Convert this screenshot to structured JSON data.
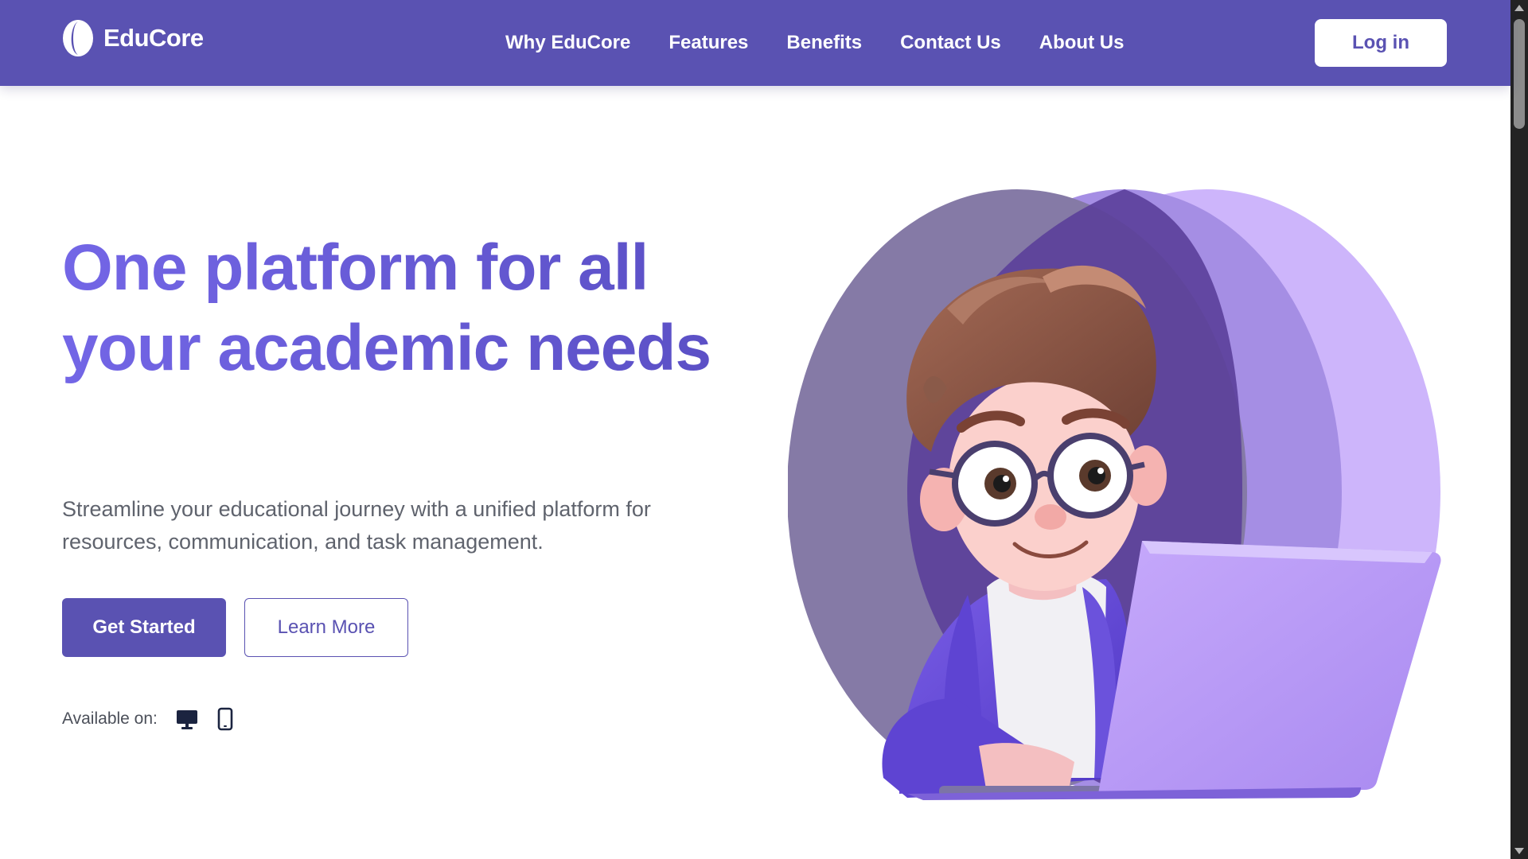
{
  "header": {
    "brand_name": "EduCore",
    "logo_icon": "half-moon-logo-icon",
    "nav": [
      {
        "label": "Why EduCore"
      },
      {
        "label": "Features"
      },
      {
        "label": "Benefits"
      },
      {
        "label": "Contact Us"
      },
      {
        "label": "About Us"
      }
    ],
    "login_label": "Log in"
  },
  "hero": {
    "title": "One platform for all your academic needs",
    "subtitle": "Streamline your educational journey with a unified platform for resources, communication, and task management.",
    "primary_button": "Get Started",
    "secondary_button": "Learn More",
    "available_label": "Available on:",
    "platform_icons": [
      "desktop-icon",
      "mobile-icon"
    ],
    "illustration": "student-with-laptop-illustration"
  },
  "colors": {
    "brand": "#5a52b2",
    "title_start": "#7366e6",
    "title_end": "#5a4fc4",
    "circle_1": "#857aa6",
    "circle_2": "#a58ee4",
    "circle_3": "#cdb5fb",
    "text_muted": "#5f636d"
  }
}
